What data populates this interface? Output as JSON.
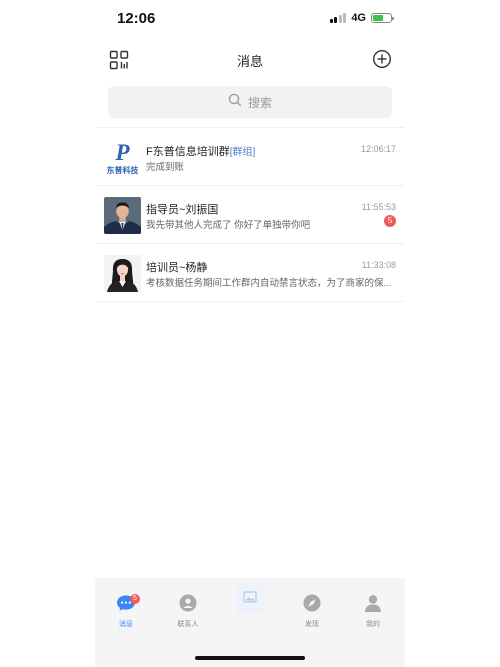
{
  "status_bar": {
    "time": "12:06",
    "network": "4G"
  },
  "nav": {
    "title": "消息"
  },
  "search": {
    "placeholder": "搜索"
  },
  "conversations": [
    {
      "title": "F东普信息培训群",
      "tag": "[群组]",
      "time": "12:06:17",
      "preview": "完成到账",
      "badge": "",
      "logo_text": "东普科技",
      "logo_letter": "P"
    },
    {
      "title": "指导员~刘振国",
      "tag": "",
      "time": "11:55:53",
      "preview": "我先带其他人完成了  你好了单独带你吧",
      "badge": "5"
    },
    {
      "title": "培训员~杨静",
      "tag": "",
      "time": "11:33:08",
      "preview": "考核数据任务期间工作群内自动禁言状态，为了商家的保...",
      "badge": ""
    }
  ],
  "tabs": [
    {
      "label": "消息",
      "badge": "5",
      "active": true
    },
    {
      "label": "联系人"
    },
    {
      "label": ""
    },
    {
      "label": "发现"
    },
    {
      "label": "我的"
    }
  ],
  "colors": {
    "accent": "#3b86f7",
    "badge": "#f25b5b",
    "group_tag": "#4a7dc9",
    "logo_blue": "#2f63b0",
    "battery": "#3cc24a"
  }
}
